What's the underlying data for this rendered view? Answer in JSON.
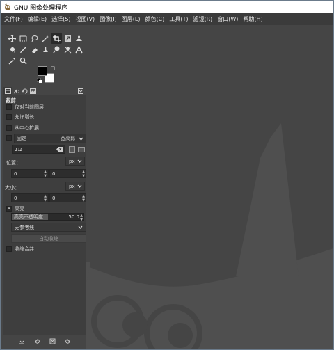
{
  "window": {
    "title": "GNU 图像处理程序"
  },
  "menu": [
    "文件(F)",
    "编辑(E)",
    "选择(S)",
    "视图(V)",
    "图像(I)",
    "图层(L)",
    "颜色(C)",
    "工具(T)",
    "滤镜(R)",
    "窗口(W)",
    "帮助(H)"
  ],
  "tool_icons": [
    [
      "move-icon",
      "rect-select-icon",
      "lasso-icon",
      "fuzzy-select-icon",
      "crop-icon",
      "transform-icon",
      "warp-icon"
    ],
    [
      "bucket-fill-icon",
      "paintbrush-icon",
      "eraser-icon",
      "clone-icon",
      "smudge-icon",
      "dodge-icon",
      "text-icon"
    ],
    [
      "color-picker-icon",
      "zoom-icon"
    ]
  ],
  "options": {
    "title": "裁剪",
    "current_layer_only": "仅对当前图层",
    "allow_growing": "允许增长",
    "expand_from_center": "从中心扩展",
    "fixed": "固定",
    "fixed_mode": "宽高比",
    "ratio_value": "1:1",
    "position_label": "位置：",
    "position_unit": "px",
    "position_x": "0",
    "position_y": "0",
    "size_label": "大小：",
    "size_unit": "px",
    "size_w": "0",
    "size_h": "0",
    "highlight": "高亮",
    "highlight_opacity_label": "高亮不透明度",
    "highlight_opacity_value": "50.0",
    "highlight_opacity_fraction": 0.5,
    "guides": "无参考线",
    "auto_shrink": "自动收缩",
    "shrink_merged": "收缩合并"
  },
  "colors": {
    "foreground": "#000000",
    "background": "#ffffff",
    "panel": "#3e3e3e",
    "wilber": "#4f4f4f"
  }
}
